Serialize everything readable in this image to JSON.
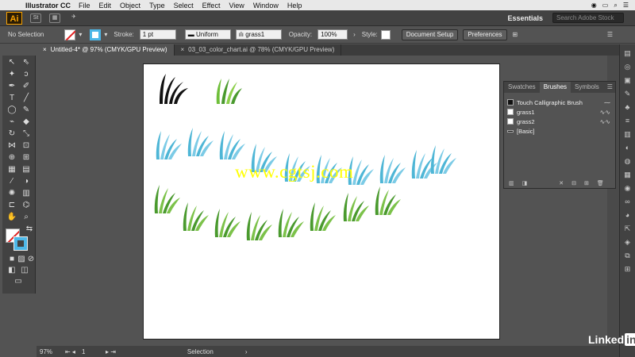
{
  "menubar": {
    "app_name": "Illustrator CC",
    "items": [
      "File",
      "Edit",
      "Object",
      "Type",
      "Select",
      "Effect",
      "View",
      "Window",
      "Help"
    ]
  },
  "appbar": {
    "logo": "Ai",
    "workspace": "Essentials",
    "search_placeholder": "Search Adobe Stock",
    "st_label": "St"
  },
  "control_bar": {
    "selection": "No Selection",
    "stroke_label": "Stroke:",
    "stroke_value": "1 pt",
    "profile": "Uniform",
    "brush": "grass1",
    "opacity_label": "Opacity:",
    "opacity_value": "100%",
    "style_label": "Style:",
    "doc_setup": "Document Setup",
    "preferences": "Preferences"
  },
  "tabs": [
    {
      "label": "Untitled-4* @ 97% (CMYK/GPU Preview)",
      "close": "×"
    },
    {
      "label": "03_03_color_chart.ai @ 78% (CMYK/GPU Preview)",
      "close": "×"
    }
  ],
  "brushes_panel": {
    "tabs": [
      "Swatches",
      "Brushes",
      "Symbols"
    ],
    "items": [
      {
        "label": "Touch Calligraphic Brush"
      },
      {
        "label": "grass1"
      },
      {
        "label": "grass2"
      },
      {
        "label": "[Basic]"
      }
    ]
  },
  "status_bar": {
    "zoom": "97%",
    "page": "1",
    "tool": "Selection"
  },
  "watermark": "www.cgtsj.com",
  "branding": {
    "left": "Linked",
    "right": "in"
  },
  "colors": {
    "grass_blue": "#4eb6d6",
    "grass_green": "#4a9a2e",
    "stroke_swatch": "#4db8e8"
  }
}
